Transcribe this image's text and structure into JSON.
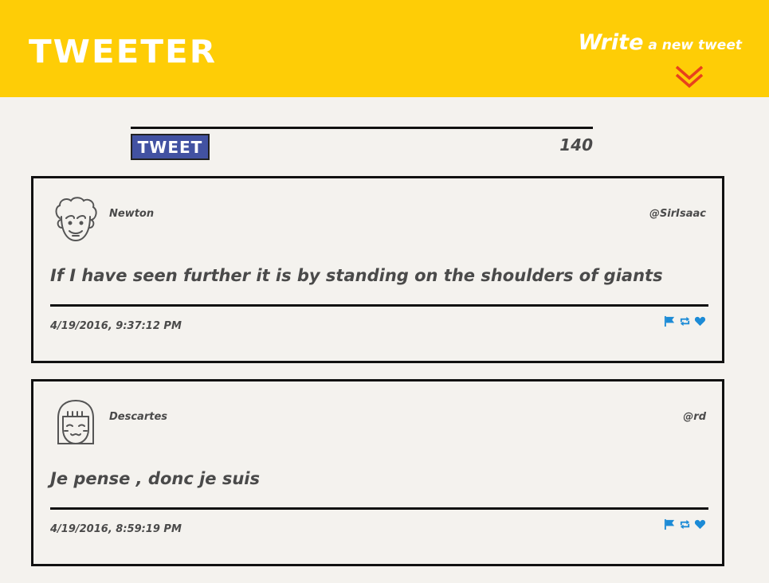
{
  "header": {
    "logo": "TWEETER",
    "compose_big": "Write",
    "compose_small": " a new tweet",
    "chevron_icon": "double-chevron-down-icon",
    "bg_color": "#fecd06"
  },
  "compose": {
    "button_label": "TWEET",
    "counter": "140",
    "button_color": "#4252a2"
  },
  "tweets": [
    {
      "name": "Newton",
      "handle": "@SirIsaac",
      "content": "If I have seen further it is by standing on the shoulders of giants",
      "timestamp": "4/19/2016, 9:37:12 PM",
      "avatar_icon": "curly-hair-face-icon"
    },
    {
      "name": "Descartes",
      "handle": "@rd",
      "content": "Je pense , donc je suis",
      "timestamp": "4/19/2016, 8:59:19 PM",
      "avatar_icon": "bob-hair-face-icon"
    }
  ],
  "action_icons": [
    "flag-icon",
    "retweet-icon",
    "heart-icon"
  ],
  "accent_color": "#1c8bd6"
}
